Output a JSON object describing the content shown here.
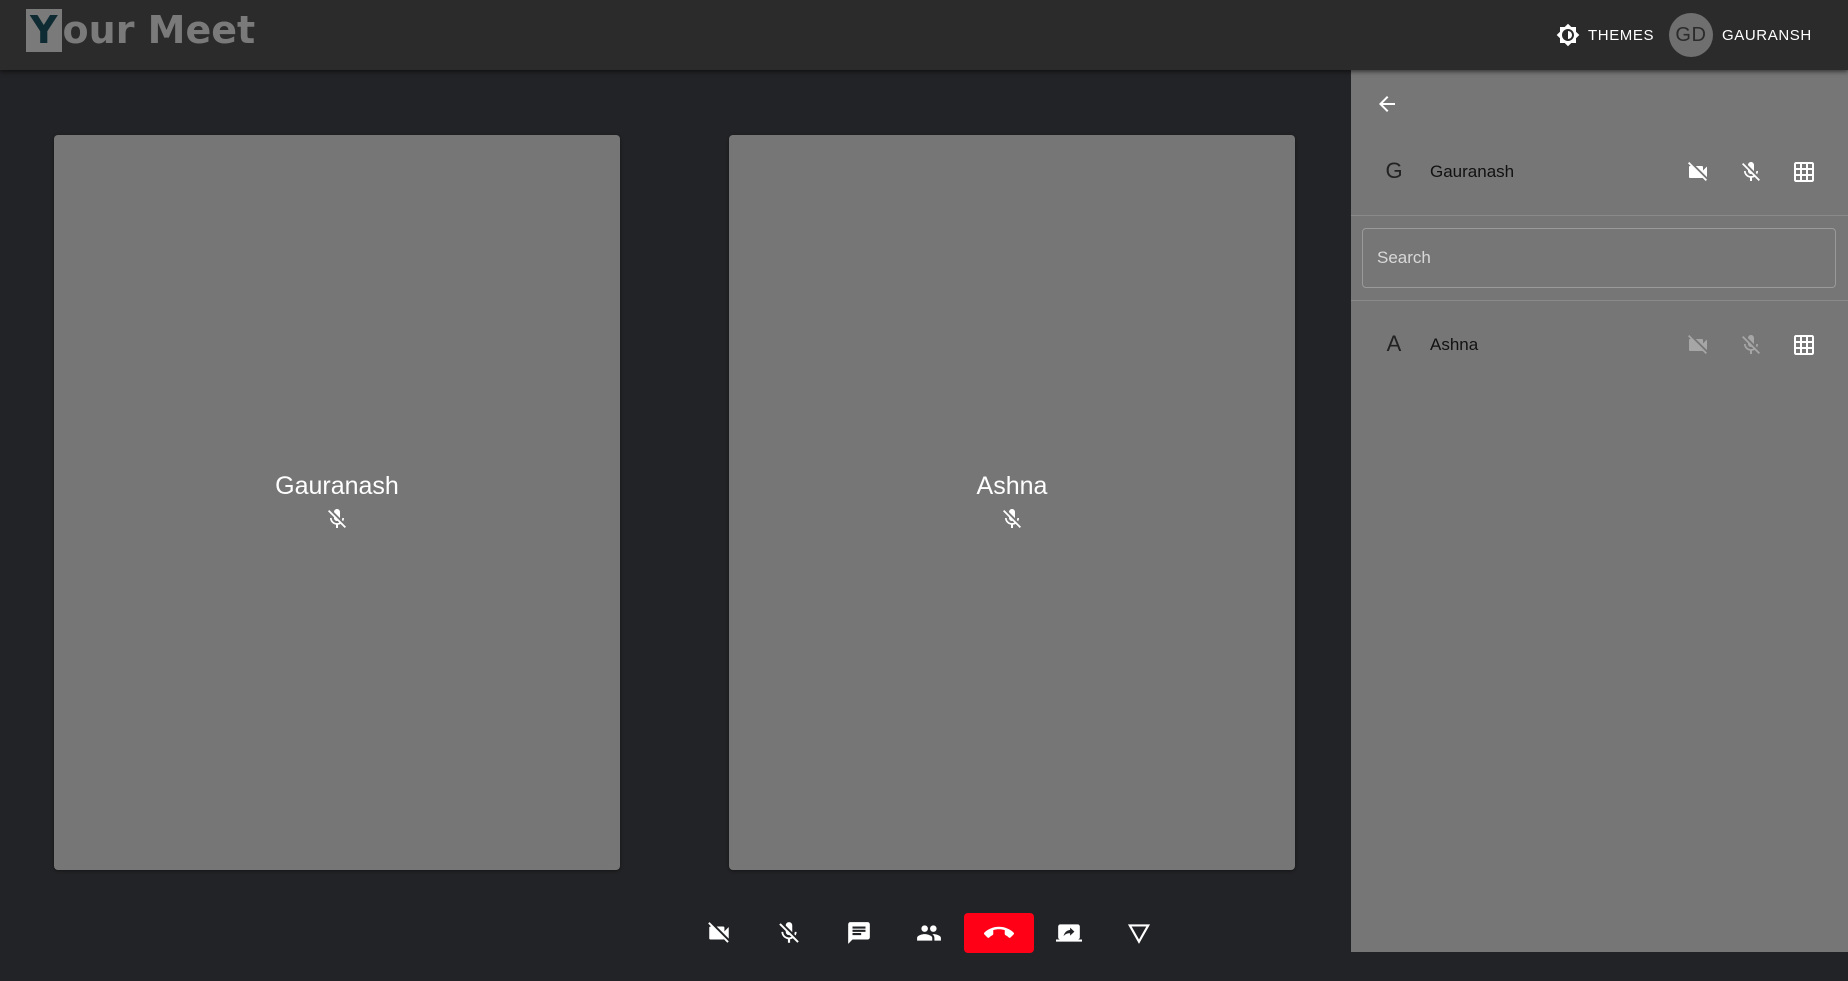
{
  "header": {
    "logo_first": "Y",
    "logo_rest": "our Meet",
    "themes_label": "THEMES",
    "user_initials": "GD",
    "user_name": "GAURANSH"
  },
  "tiles": [
    {
      "name": "Gauranash",
      "mic": "mic-off-icon"
    },
    {
      "name": "Ashna",
      "mic": "mic-off-icon"
    }
  ],
  "toolbar": {
    "buttons": [
      "videocam-off-icon",
      "mic-off-icon",
      "chat-icon",
      "people-icon",
      "call-end-icon",
      "screen-share-icon",
      "triangle-down-icon"
    ],
    "end_call_color": "#ff0016"
  },
  "panel": {
    "self": {
      "initial": "G",
      "name": "Gauranash"
    },
    "search_placeholder": "Search",
    "participants": [
      {
        "initial": "A",
        "name": "Ashna"
      }
    ]
  }
}
